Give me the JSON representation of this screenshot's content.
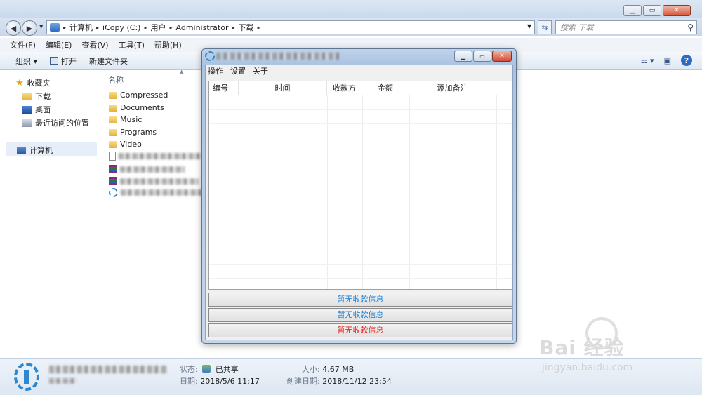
{
  "explorer": {
    "breadcrumb": [
      "计算机",
      "iCopy (C:)",
      "用户",
      "Administrator",
      "下载"
    ],
    "search_placeholder": "搜索 下载",
    "menu": [
      "文件(F)",
      "编辑(E)",
      "查看(V)",
      "工具(T)",
      "帮助(H)"
    ],
    "toolbar": {
      "organize": "组织 ▾",
      "open": "打开",
      "new_folder": "新建文件夹"
    },
    "nav": {
      "favorites": "收藏夹",
      "downloads": "下载",
      "desktop": "桌面",
      "recent": "最近访问的位置",
      "computer": "计算机"
    },
    "column_name": "名称",
    "folders": [
      "Compressed",
      "Documents",
      "Music",
      "Programs",
      "Video"
    ],
    "details": {
      "status_label": "状态:",
      "status_value": "已共享",
      "modified_label": "日期:",
      "modified_value": "2018/5/6 11:17",
      "size_label": "大小:",
      "size_value": "4.67 MB",
      "created_label": "创建日期:",
      "created_value": "2018/11/12 23:54"
    }
  },
  "dialog": {
    "menu": [
      "操作",
      "设置",
      "关于"
    ],
    "columns": [
      "编号",
      "时间",
      "收款方",
      "金额",
      "添加备注"
    ],
    "status_bars": [
      {
        "text": "暂无收款信息",
        "color": "#1a7fd4"
      },
      {
        "text": "暂无收款信息",
        "color": "#1a7fd4"
      },
      {
        "text": "暂无收款信息",
        "color": "#e3211b"
      }
    ]
  },
  "watermark": {
    "brand": "Bai 经验",
    "url": "jingyan.baidu.com"
  }
}
